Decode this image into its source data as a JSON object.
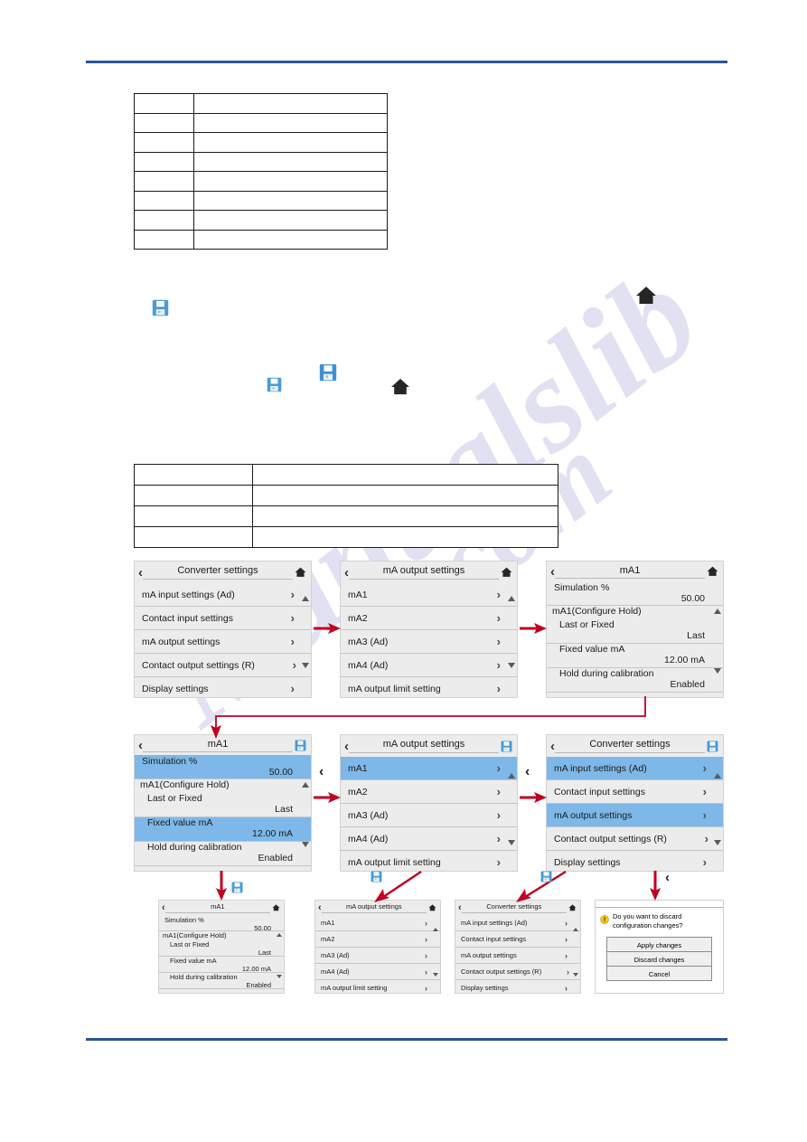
{
  "document": {
    "rules": {
      "color": "#2b5497"
    },
    "watermark": {
      "line1": "Manualslib",
      "line2": ".com"
    }
  },
  "tables": {
    "table_a": {
      "rows": 8,
      "cols": 2,
      "cells": []
    },
    "table_b": {
      "rows": 4,
      "cols": 2,
      "cells": []
    }
  },
  "inline_icons": {
    "save_1": "save-floppy-icon",
    "home_1": "home-icon",
    "save_2": "save-floppy-icon",
    "save_3": "save-floppy-icon",
    "home_2": "home-icon"
  },
  "icons": {
    "back": "‹",
    "chevron_right": "›",
    "home": "home-icon",
    "save": "save-floppy-icon",
    "warning": "warning-icon",
    "scroll_up": "triangle-up-icon",
    "scroll_down": "triangle-down-icon"
  },
  "panels": {
    "r1c1": {
      "title": "Converter settings",
      "header_icon": "home-icon",
      "items": [
        {
          "label": "mA input settings (Ad)",
          "chevron": "›",
          "selected": false
        },
        {
          "label": "Contact input settings",
          "chevron": "›",
          "selected": false
        },
        {
          "label": "mA output settings",
          "chevron": "›",
          "selected": false
        },
        {
          "label": "Contact output settings (R)",
          "chevron": "›",
          "selected": false
        },
        {
          "label": "Display settings",
          "chevron": "›",
          "selected": false
        }
      ]
    },
    "r1c2": {
      "title": "mA output settings",
      "header_icon": "home-icon",
      "items": [
        {
          "label": "mA1",
          "chevron": "›",
          "selected": false
        },
        {
          "label": "mA2",
          "chevron": "›",
          "selected": false
        },
        {
          "label": "mA3 (Ad)",
          "chevron": "›",
          "selected": false
        },
        {
          "label": "mA4 (Ad)",
          "chevron": "›",
          "selected": false
        },
        {
          "label": "mA output limit setting",
          "chevron": "›",
          "selected": false
        }
      ]
    },
    "r1c3": {
      "title": "mA1",
      "header_icon": "home-icon",
      "items": [
        {
          "label": "Simulation %",
          "value": "50.00",
          "selected": false,
          "sub": false
        },
        {
          "label": "mA1(Configure Hold)",
          "value": "",
          "selected": false,
          "sub": false,
          "group": true
        },
        {
          "label": "Last or Fixed",
          "value": "Last",
          "selected": false,
          "sub": true
        },
        {
          "label": "Fixed value mA",
          "value": "12.00 mA",
          "selected": false,
          "sub": true
        },
        {
          "label": "Hold during calibration",
          "value": "Enabled",
          "selected": false,
          "sub": true
        }
      ]
    },
    "r2c1": {
      "title": "mA1",
      "header_icon": "save-floppy-icon",
      "items": [
        {
          "label": "Simulation %",
          "value": "50.00",
          "selected": true,
          "sub": false
        },
        {
          "label": "mA1(Configure Hold)",
          "value": "",
          "selected": false,
          "sub": false,
          "group": true
        },
        {
          "label": "Last or Fixed",
          "value": "Last",
          "selected": false,
          "sub": true
        },
        {
          "label": "Fixed value mA",
          "value": "12.00 mA",
          "selected": true,
          "sub": true
        },
        {
          "label": "Hold during calibration",
          "value": "Enabled",
          "selected": false,
          "sub": true
        }
      ]
    },
    "r2c2": {
      "title": "mA output settings",
      "header_icon": "save-floppy-icon",
      "items": [
        {
          "label": "mA1",
          "chevron": "›",
          "selected": true
        },
        {
          "label": "mA2",
          "chevron": "›",
          "selected": false
        },
        {
          "label": "mA3 (Ad)",
          "chevron": "›",
          "selected": false
        },
        {
          "label": "mA4 (Ad)",
          "chevron": "›",
          "selected": false
        },
        {
          "label": "mA output limit setting",
          "chevron": "›",
          "selected": false
        }
      ]
    },
    "r2c3": {
      "title": "Converter settings",
      "header_icon": "save-floppy-icon",
      "items": [
        {
          "label": "mA input settings (Ad)",
          "chevron": "›",
          "selected": true
        },
        {
          "label": "Contact input settings",
          "chevron": "›",
          "selected": false
        },
        {
          "label": "mA output settings",
          "chevron": "›",
          "selected": true
        },
        {
          "label": "Contact output settings (R)",
          "chevron": "›",
          "selected": false
        },
        {
          "label": "Display settings",
          "chevron": "›",
          "selected": false
        }
      ]
    },
    "r3c1": {
      "title": "mA1",
      "header_icon": "home-icon",
      "items": [
        {
          "label": "Simulation %",
          "value": "50.00",
          "selected": false,
          "sub": false
        },
        {
          "label": "mA1(Configure Hold)",
          "value": "",
          "selected": false,
          "sub": false,
          "group": true
        },
        {
          "label": "Last or Fixed",
          "value": "Last",
          "selected": false,
          "sub": true
        },
        {
          "label": "Fixed value mA",
          "value": "12.00 mA",
          "selected": false,
          "sub": true
        },
        {
          "label": "Hold during calibration",
          "value": "Enabled",
          "selected": false,
          "sub": true
        }
      ]
    },
    "r3c2": {
      "title": "mA output settings",
      "header_icon": "home-icon",
      "items": [
        {
          "label": "mA1",
          "chevron": "›",
          "selected": false
        },
        {
          "label": "mA2",
          "chevron": "›",
          "selected": false
        },
        {
          "label": "mA3 (Ad)",
          "chevron": "›",
          "selected": false
        },
        {
          "label": "mA4 (Ad)",
          "chevron": "›",
          "selected": false
        },
        {
          "label": "mA output limit setting",
          "chevron": "›",
          "selected": false
        }
      ]
    },
    "r3c3": {
      "title": "Converter settings",
      "header_icon": "home-icon",
      "items": [
        {
          "label": "mA input settings (Ad)",
          "chevron": "›",
          "selected": false
        },
        {
          "label": "Contact input settings",
          "chevron": "›",
          "selected": false
        },
        {
          "label": "mA output settings",
          "chevron": "›",
          "selected": false
        },
        {
          "label": "Contact output settings (R)",
          "chevron": "›",
          "selected": false
        },
        {
          "label": "Display settings",
          "chevron": "›",
          "selected": false
        }
      ]
    }
  },
  "dialog": {
    "message_line1": "Do you want to discard",
    "message_line2": "configuration changes?",
    "buttons": [
      {
        "label": "Apply changes"
      },
      {
        "label": "Discard changes"
      },
      {
        "label": "Cancel"
      }
    ]
  },
  "flow_icons": {
    "save_above_r3c1": "save-floppy-icon",
    "save_above_r3c2": "save-floppy-icon",
    "save_above_r3c3": "save-floppy-icon",
    "back_above_dialog": "‹"
  },
  "colors": {
    "rule": "#2b5497",
    "selection": "#7db8e8",
    "arrow": "#c00020",
    "panel_bg": "#ececec",
    "save_icon": "#4a9ad8",
    "warning": "#f5c518"
  }
}
